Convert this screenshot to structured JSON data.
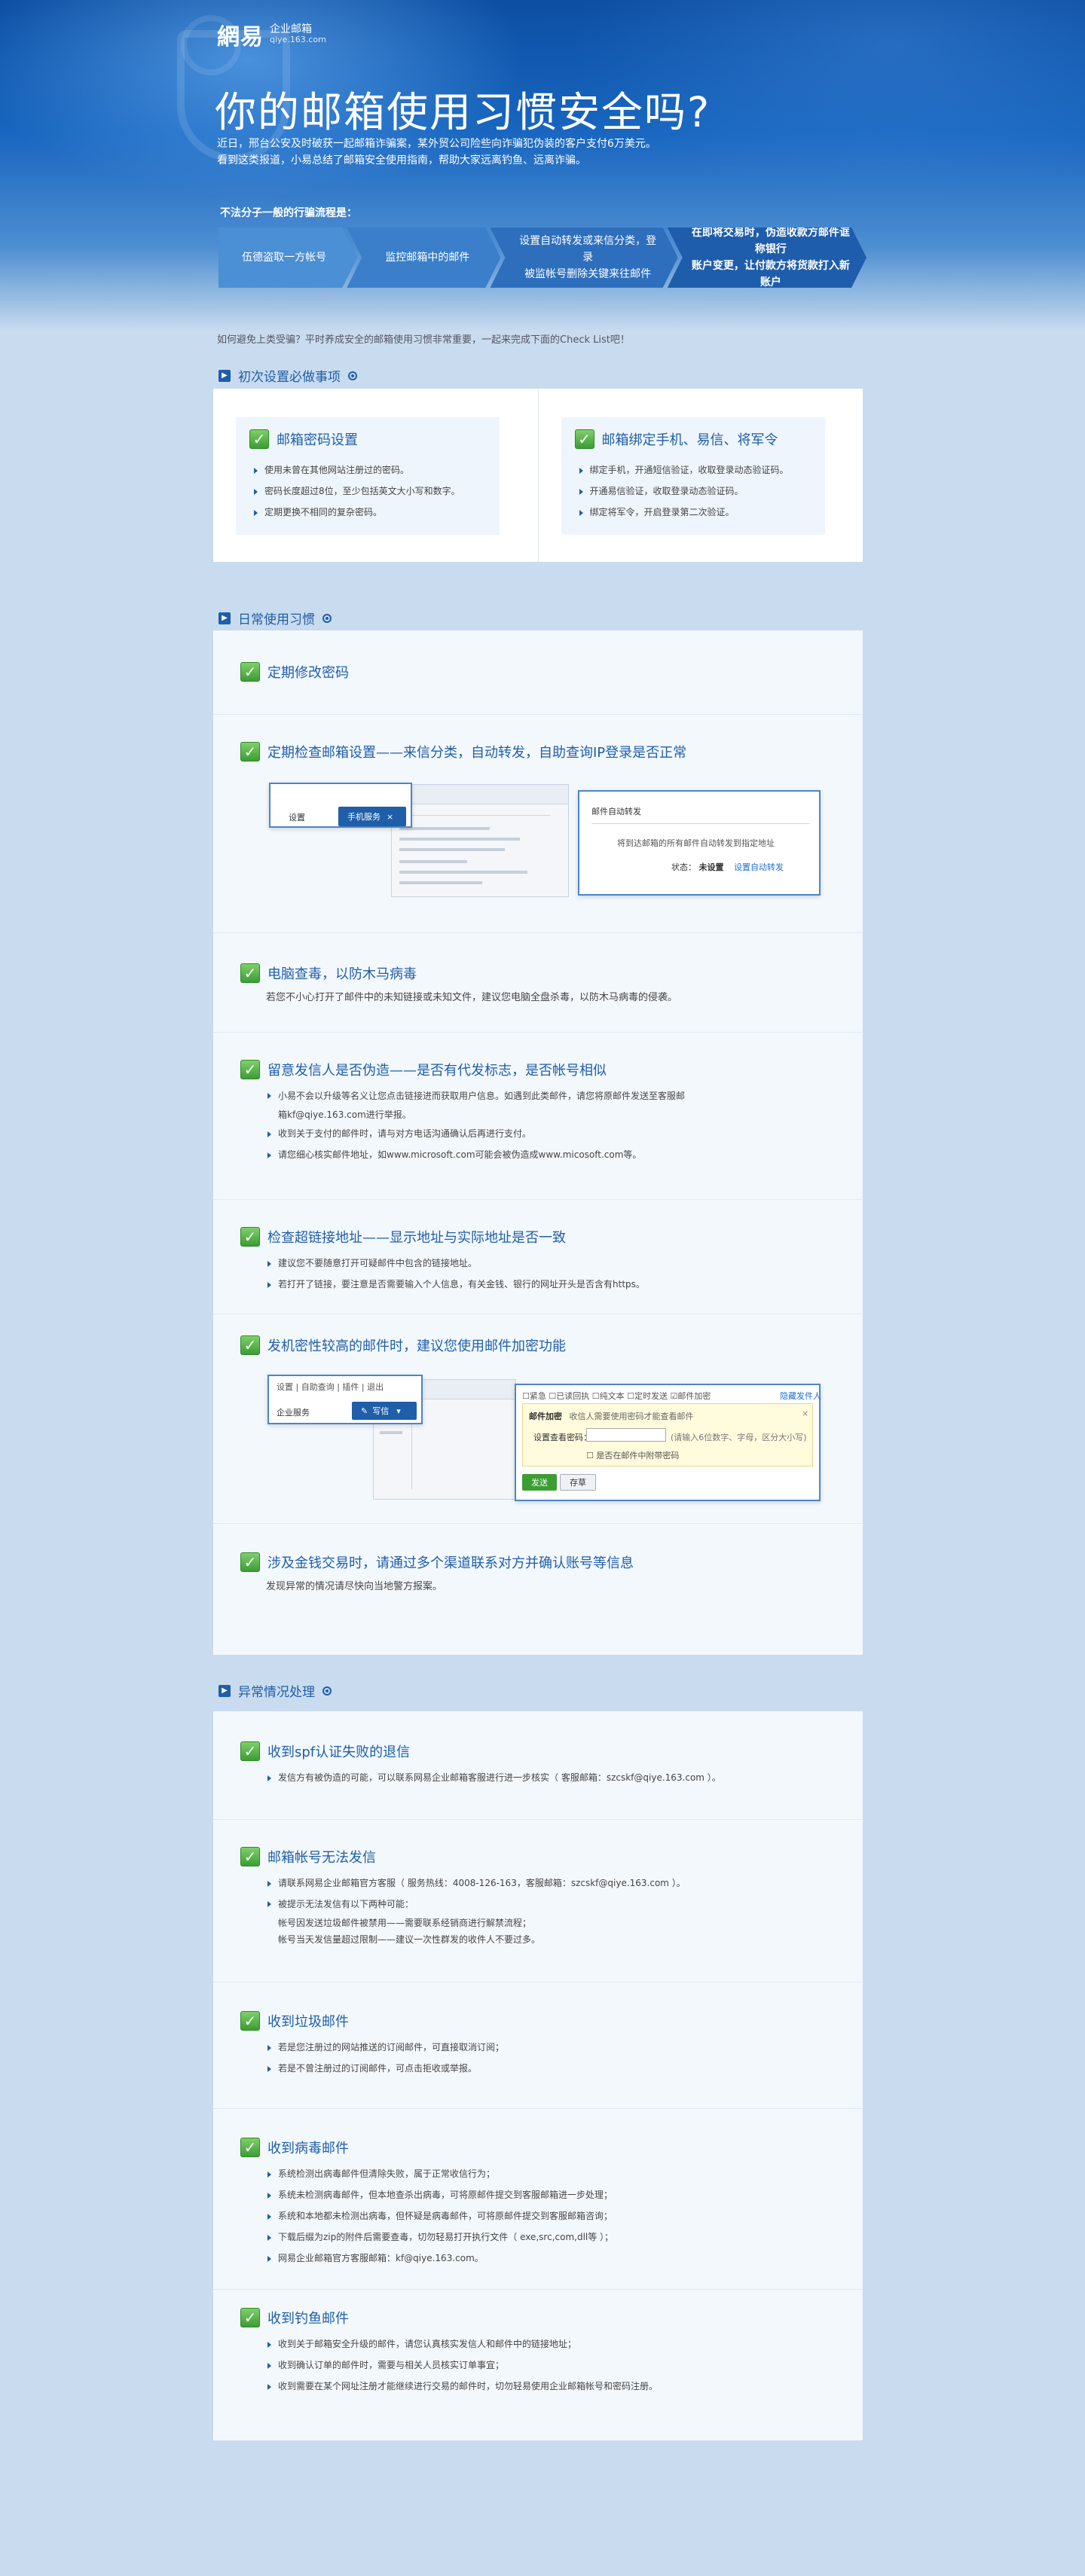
{
  "logo": {
    "mark": "網易",
    "name": "企业邮箱",
    "domain": "qiye.163.com"
  },
  "hero": {
    "title": "你的邮箱使用习惯安全吗?",
    "desc_line1": "近日，邢台公安及时破获一起邮箱诈骗案，某外贸公司险些向诈骗犯伪装的客户支付6万美元。",
    "desc_line2": "看到这类报道，小易总结了邮箱安全使用指南，帮助大家远离钓鱼、远离诈骗。"
  },
  "steps": {
    "label": "不法分子一般的行骗流程是：",
    "items": [
      {
        "line1": "伍德盗取一方帐号",
        "line2": ""
      },
      {
        "line1": "监控邮箱中的邮件",
        "line2": ""
      },
      {
        "line1": "设置自动转发或来信分类，登录",
        "line2": "被监帐号删除关键来往邮件"
      },
      {
        "line1": "在即将交易时，伪造收款方邮件诓称银行",
        "line2": "账户变更，让付款方将货款打入新账户"
      }
    ]
  },
  "intro": "如何避免上类受骗？平时养成安全的邮箱使用习惯非常重要，一起来完成下面的Check List吧！",
  "sections": {
    "setup": "初次设置必做事项",
    "daily": "日常使用习惯",
    "abnormal": "异常情况处理"
  },
  "setup": {
    "password": {
      "title": "邮箱密码设置",
      "items": [
        "使用未曾在其他网站注册过的密码。",
        "密码长度超过8位，至少包括英文大小写和数字。",
        "定期更换不相同的复杂密码。"
      ]
    },
    "bind": {
      "title": "邮箱绑定手机、易信、将军令",
      "items": [
        "绑定手机，开通短信验证，收取登录动态验证码。",
        "开通易信验证，收取登录动态验证码。",
        "绑定将军令，开启登录第二次验证。"
      ]
    }
  },
  "daily": {
    "r1": {
      "title": "定期修改密码"
    },
    "r2": {
      "title": "定期检查邮箱设置——来信分类，自动转发，自助查询IP登录是否正常",
      "mock": {
        "tab_settings": "设置",
        "tab_phone": "手机服务",
        "popup_title": "邮件自动转发",
        "popup_desc": "将到达邮箱的所有邮件自动转发到指定地址",
        "status_label": "状态：",
        "status_value": "未设置",
        "status_link": "设置自动转发"
      }
    },
    "r3": {
      "title": "电脑查毒，以防木马病毒",
      "sub": "若您不小心打开了邮件中的未知链接或未知文件，建议您电脑全盘杀毒，以防木马病毒的侵袭。"
    },
    "r4": {
      "title": "留意发信人是否伪造——是否有代发标志，是否帐号相似",
      "items": [
        "小易不会以升级等名义让您点击链接进而获取用户信息。如遇到此类邮件，请您将原邮件发送至客服邮",
        "箱kf@qiye.163.com进行举报。",
        "收到关于支付的邮件时，请与对方电话沟通确认后再进行支付。",
        "请您细心核实邮件地址，如www.microsoft.com可能会被伪造成www.micosoft.com等。"
      ]
    },
    "r5": {
      "title": "检查超链接地址——显示地址与实际地址是否一致",
      "items": [
        "建议您不要随意打开可疑邮件中包含的链接地址。",
        "若打开了链接，要注意是否需要输入个人信息，有关金钱、银行的网址开头是否含有https。"
      ]
    },
    "r6": {
      "title": "发机密性较高的邮件时，建议您使用邮件加密功能",
      "mock": {
        "menu_settings": "设置",
        "menu_self": "自助查询",
        "menu_plugin": "插件",
        "menu_exit": "退出",
        "service": "企业服务",
        "write": "写信",
        "opt1": "紧急",
        "opt2": "已读回执",
        "opt3": "纯文本",
        "opt4": "定时发送",
        "opt5": "邮件加密",
        "sign": "隐藏发件人",
        "enc_title": "邮件加密",
        "enc_desc": "收信人需要使用密码才能查看邮件",
        "pwd_label": "设置查看密码：",
        "pwd_hint": "(请输入6位数字、字母，区分大小写)",
        "remember": "是否在邮件中附带密码",
        "send": "发送",
        "save": "存草"
      }
    },
    "r7": {
      "title": "涉及金钱交易时，请通过多个渠道联系对方并确认账号等信息",
      "sub": "发现异常的情况请尽快向当地警方报案。"
    }
  },
  "abnormal": {
    "a1": {
      "title": "收到spf认证失败的退信",
      "items": [
        "发信方有被伪造的可能，可以联系网易企业邮箱客服进行进一步核实（ 客服邮箱：szcskf@qiye.163.com ）。"
      ]
    },
    "a2": {
      "title": "邮箱帐号无法发信",
      "items": [
        "请联系网易企业邮箱官方客服（ 服务热线：4008-126-163，客服邮箱：szcskf@qiye.163.com ）。",
        "被提示无法发信有以下两种可能："
      ],
      "cont": [
        "帐号因发送垃圾邮件被禁用——需要联系经销商进行解禁流程；",
        "帐号当天发信量超过限制——建议一次性群发的收件人不要过多。"
      ]
    },
    "a3": {
      "title": "收到垃圾邮件",
      "items": [
        "若是您注册过的网站推送的订阅邮件，可直接取消订阅；",
        "若是不曾注册过的订阅邮件，可点击拒收或举报。"
      ]
    },
    "a4": {
      "title": "收到病毒邮件",
      "items": [
        "系统检测出病毒邮件但清除失败，属于正常收信行为；",
        "系统未检测病毒邮件，但本地查杀出病毒，可将原邮件提交到客服邮箱进一步处理；",
        "系统和本地都未检测出病毒，但怀疑是病毒邮件，可将原邮件提交到客服邮箱咨询；",
        "下载后缀为zip的附件后需要查毒，切勿轻易打开执行文件（ exe,src,com,dll等 ）；",
        "网易企业邮箱官方客服邮箱：kf@qiye.163.com。"
      ]
    },
    "a5": {
      "title": "收到钓鱼邮件",
      "items": [
        "收到关于邮箱安全升级的邮件，请您认真核实发信人和邮件中的链接地址；",
        "收到确认订单的邮件时，需要与相关人员核实订单事宜；",
        "收到需要在某个网址注册才能继续进行交易的邮件时，切勿轻易使用企业邮箱帐号和密码注册。"
      ]
    }
  },
  "colors": {
    "accent": "#1f5ea8",
    "check": "#3c9d33",
    "panel_bg": "#f3f8fd"
  }
}
